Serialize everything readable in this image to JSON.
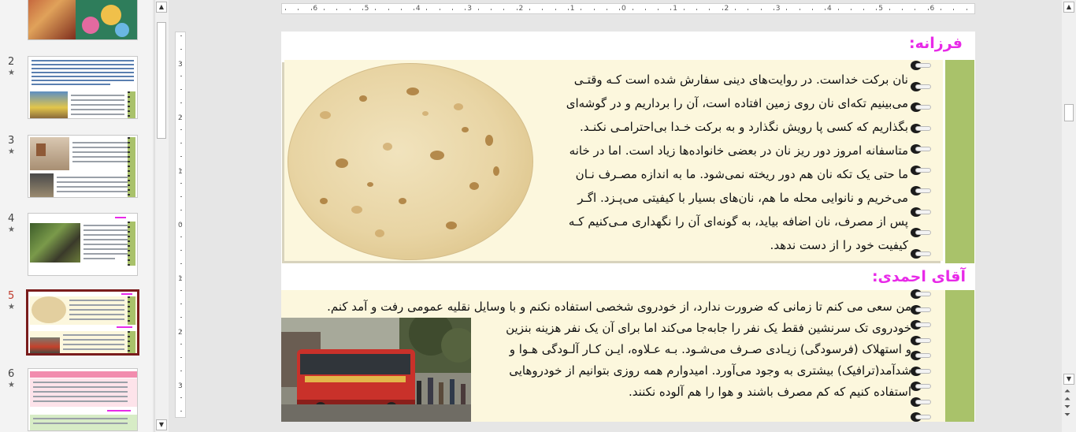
{
  "thumbnails": [
    {
      "num": "",
      "star": ""
    },
    {
      "num": "2",
      "star": "★"
    },
    {
      "num": "3",
      "star": "★"
    },
    {
      "num": "4",
      "star": "★"
    },
    {
      "num": "5",
      "star": "★"
    },
    {
      "num": "6",
      "star": "★"
    }
  ],
  "ruler_h": [
    "6",
    "5",
    "4",
    "3",
    "2",
    "1",
    "0",
    "1",
    "2",
    "3",
    "4",
    "5",
    "6"
  ],
  "ruler_v": [
    "3",
    "2",
    "1",
    "0",
    "1",
    "2",
    "3"
  ],
  "slide": {
    "heading1": "فرزانه:",
    "paragraph1": [
      "نان برکت خداست. در روایت‌های دینی سفارش شده است کـه وقتـی",
      "می‌بینیم تکه‌ای نان روی زمین افتاده است، آن را برداریم و در گوشه‌ای",
      "بگذاریم که کسی پا رویش نگذارد و به برکت خـدا بی‌احترامـی نکنـد.",
      "متاسفانه امروز دور ریز نان در بعضی خانواده‌ها زیاد است. اما در خانه",
      "ما حتی یک تکه نان هم دور ریخته نمی‌شود. ما به اندازه مصـرف نـان",
      "می‌خریم و نانوایی محله ما هم، نان‌های بسیار با کیفیتی می‌پـزد. اگـر",
      "پس از مصرف، نان اضافه بیاید، به گونه‌ای آن را نگهداری مـی‌کنیم کـه",
      "کیفیت خود را از دست ندهد."
    ],
    "heading2": "آقای احمدی:",
    "paragraph2_top": "من سعی می کنم تا زمانی که ضرورت ندارد، از خودروی شخصی استفاده نکنم و با وسایل نقلیه عمومی رفت و آمد کنم.",
    "paragraph2": [
      "خودروی تک سرنشین فقط یک نفر را جابه‌جا می‌کند اما برای آن یک نفر هزینه بنزین",
      "و استهلاک (فرسودگی) زیـادی صـرف می‌شـود. بـه عـلاوه، ایـن کـار آلـودگی هـوا و",
      "شدآمد(ترافیک) بیشتری به وجود می‌آورد. امیدوارم همه روزی بتوانیم از خودروهایی",
      "استفاده کنیم که کم مصرف باشند و هوا را هم آلوده نکنند."
    ]
  },
  "colors": {
    "heading": "#e82ae8",
    "spine": "#a9c26a",
    "panel": "#fcf7dd",
    "active_thumb_border": "#7a1c1c"
  },
  "icons": [
    "scroll-up-icon",
    "scroll-down-icon",
    "star-icon",
    "prev-slide-icon",
    "next-slide-icon"
  ]
}
